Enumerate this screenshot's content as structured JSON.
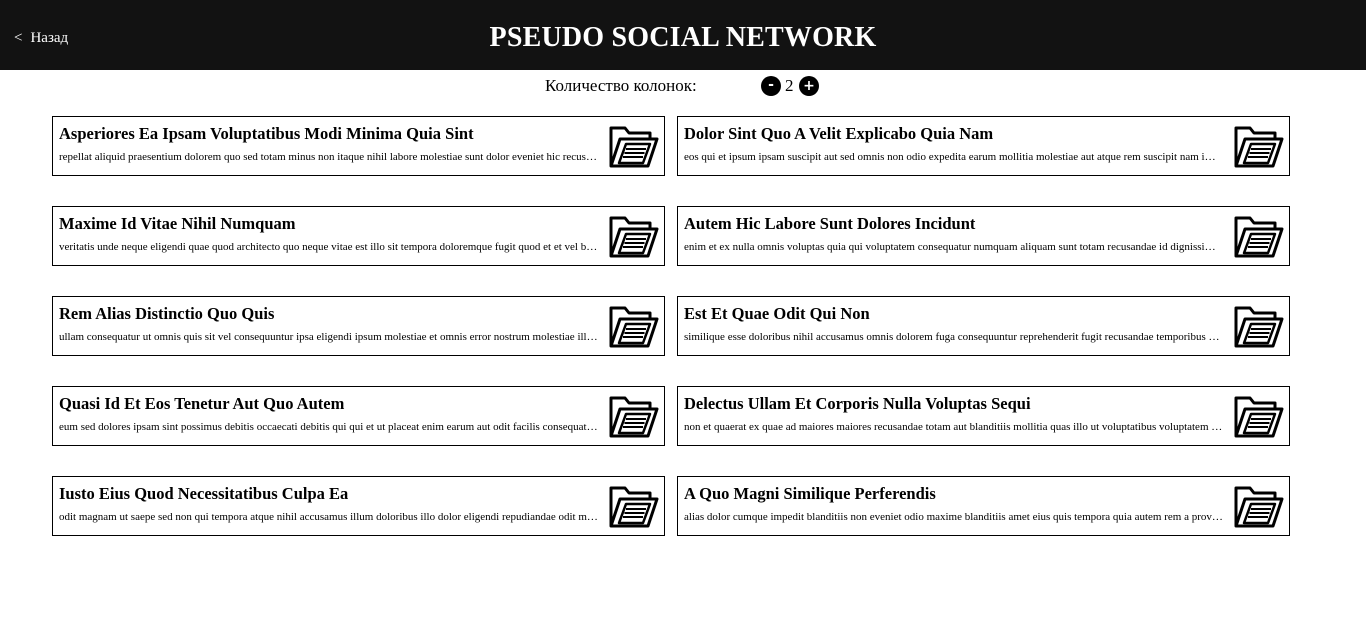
{
  "header": {
    "back_label": "Назад",
    "back_chevron": "<",
    "title": "PSEUDO SOCIAL NETWORK"
  },
  "controls": {
    "label": "Количество колонок:",
    "minus": "-",
    "count": "2",
    "plus": "+"
  },
  "posts": [
    {
      "title": "Asperiores Ea Ipsam Voluptatibus Modi Minima Quia Sint",
      "body": "repellat aliquid praesentium dolorem quo sed totam minus non itaque nihil labore molestiae sunt dolor eveniet hic recusandae veniam tempora et tenetur expedita sunt",
      "icon": "folder-document-icon"
    },
    {
      "title": "Dolor Sint Quo A Velit Explicabo Quia Nam",
      "body": "eos qui et ipsum ipsam suscipit aut sed omnis non odio expedita earum mollitia molestiae aut atque rem suscipit nam impedit esse",
      "icon": "folder-document-icon"
    },
    {
      "title": "Maxime Id Vitae Nihil Numquam",
      "body": "veritatis unde neque eligendi quae quod architecto quo neque vitae est illo sit tempora doloremque fugit quod et et vel beatae sequi ullam sed tenetur perspiciatis",
      "icon": "folder-document-icon"
    },
    {
      "title": "Autem Hic Labore Sunt Dolores Incidunt",
      "body": "enim et ex nulla omnis voluptas quia qui voluptatem consequatur numquam aliquam sunt totam recusandae id dignissimos aut sed asperiores deserunt",
      "icon": "folder-document-icon"
    },
    {
      "title": "Rem Alias Distinctio Quo Quis",
      "body": "ullam consequatur ut omnis quis sit vel consequuntur ipsa eligendi ipsum molestiae et omnis error nostrum molestiae illo tempore quia et distinctio",
      "icon": "folder-document-icon"
    },
    {
      "title": "Est Et Quae Odit Qui Non",
      "body": "similique esse doloribus nihil accusamus omnis dolorem fuga consequuntur reprehenderit fugit recusandae temporibus perspiciatis cum ut laudantium",
      "icon": "folder-document-icon"
    },
    {
      "title": "Quasi Id Et Eos Tenetur Aut Quo Autem",
      "body": "eum sed dolores ipsam sint possimus debitis occaecati debitis qui qui et ut placeat enim earum aut odit facilis consequatur suscipit necessitatibus rerum sed inventore temporibus consequatur",
      "icon": "folder-document-icon"
    },
    {
      "title": "Delectus Ullam Et Corporis Nulla Voluptas Sequi",
      "body": "non et quaerat ex quae ad maiores maiores recusandae totam aut blanditiis mollitia quas illo ut voluptatibus voluptatem similique nostrum eum",
      "icon": "folder-document-icon"
    },
    {
      "title": "Iusto Eius Quod Necessitatibus Culpa Ea",
      "body": "odit magnam ut saepe sed non qui tempora atque nihil accusamus illum doloribus illo dolor eligendi repudiandae odit magni similique sed cum maiores",
      "icon": "folder-document-icon"
    },
    {
      "title": "A Quo Magni Similique Perferendis",
      "body": "alias dolor cumque impedit blanditiis non eveniet odio maxime blanditiis amet eius quis tempora quia autem rem a provident perspiciatis quia",
      "icon": "folder-document-icon"
    }
  ]
}
